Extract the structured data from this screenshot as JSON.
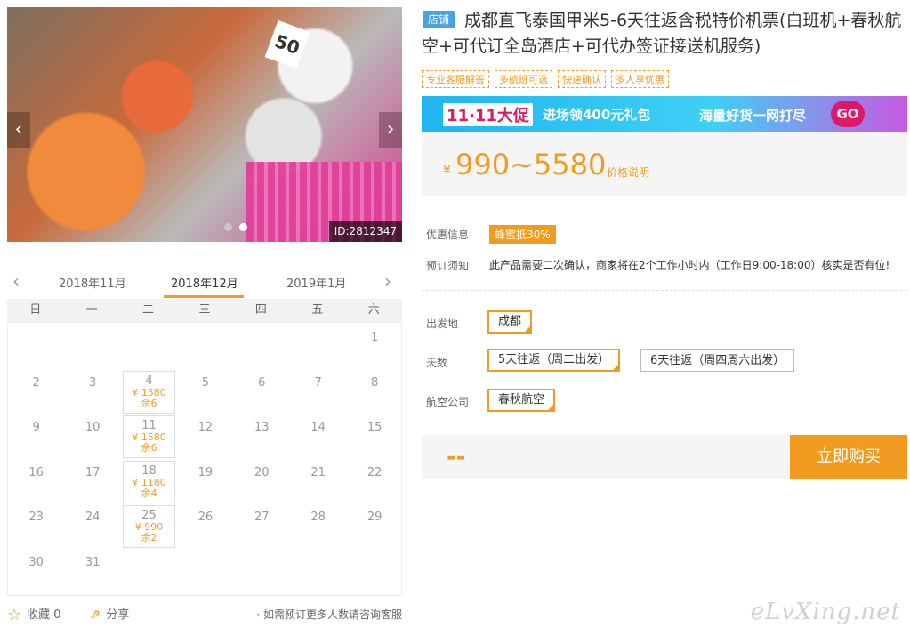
{
  "gallery": {
    "sign_text": "50",
    "image_id": "ID:2812347",
    "prev_icon": "chevron-left-icon",
    "next_icon": "chevron-right-icon"
  },
  "calendar": {
    "months": [
      "2018年11月",
      "2018年12月",
      "2019年1月"
    ],
    "active_month": "2018年12月",
    "weekdays": [
      "日",
      "一",
      "二",
      "三",
      "四",
      "五",
      "六"
    ],
    "days": [
      {
        "n": "1",
        "col": 6,
        "row": 0
      },
      {
        "n": "2",
        "col": 0,
        "row": 1
      },
      {
        "n": "3",
        "col": 1,
        "row": 1
      },
      {
        "n": "4",
        "col": 2,
        "row": 1,
        "price": "¥ 1580",
        "stock": "余6"
      },
      {
        "n": "5",
        "col": 3,
        "row": 1
      },
      {
        "n": "6",
        "col": 4,
        "row": 1
      },
      {
        "n": "7",
        "col": 5,
        "row": 1
      },
      {
        "n": "8",
        "col": 6,
        "row": 1
      },
      {
        "n": "9",
        "col": 0,
        "row": 2
      },
      {
        "n": "10",
        "col": 1,
        "row": 2
      },
      {
        "n": "11",
        "col": 2,
        "row": 2,
        "price": "¥ 1580",
        "stock": "余6"
      },
      {
        "n": "12",
        "col": 3,
        "row": 2
      },
      {
        "n": "13",
        "col": 4,
        "row": 2
      },
      {
        "n": "14",
        "col": 5,
        "row": 2
      },
      {
        "n": "15",
        "col": 6,
        "row": 2
      },
      {
        "n": "16",
        "col": 0,
        "row": 3
      },
      {
        "n": "17",
        "col": 1,
        "row": 3
      },
      {
        "n": "18",
        "col": 2,
        "row": 3,
        "price": "¥ 1180",
        "stock": "余4"
      },
      {
        "n": "19",
        "col": 3,
        "row": 3
      },
      {
        "n": "20",
        "col": 4,
        "row": 3
      },
      {
        "n": "21",
        "col": 5,
        "row": 3
      },
      {
        "n": "22",
        "col": 6,
        "row": 3
      },
      {
        "n": "23",
        "col": 0,
        "row": 4
      },
      {
        "n": "24",
        "col": 1,
        "row": 4
      },
      {
        "n": "25",
        "col": 2,
        "row": 4,
        "price": "¥ 990",
        "stock": "余2"
      },
      {
        "n": "26",
        "col": 3,
        "row": 4
      },
      {
        "n": "27",
        "col": 4,
        "row": 4
      },
      {
        "n": "28",
        "col": 5,
        "row": 4
      },
      {
        "n": "29",
        "col": 6,
        "row": 4
      },
      {
        "n": "30",
        "col": 0,
        "row": 5
      },
      {
        "n": "31",
        "col": 1,
        "row": 5
      }
    ]
  },
  "bottom": {
    "favorite_label": "收藏",
    "favorite_count": "0",
    "share_label": "分享",
    "tip": "· 如需预订更多人数请咨询客服"
  },
  "product": {
    "shop_tag": "店铺",
    "title": "成都直飞泰国甲米5-6天往返含税特价机票(白班机+春秋航空+可代订全岛酒店+可代办签证接送机服务)",
    "features": [
      "专业客服解答",
      "多航班可选",
      "快速确认",
      "多人享优惠"
    ]
  },
  "promo": {
    "badge": "11·11大促",
    "text1": "进场领400元礼包",
    "text2": "海量好货一网打尽",
    "go": "GO"
  },
  "price": {
    "currency": "¥",
    "range": "990~5580",
    "explain": "价格说明"
  },
  "info": {
    "discount_label": "优惠信息",
    "discount_value": "蜂蜜抵30%",
    "notice_label": "预订须知",
    "notice_value": "此产品需要二次确认，商家将在2个工作小时内（工作日9:00-18:00）核实是否有位!"
  },
  "options": {
    "departure_label": "出发地",
    "departure_value": "成都",
    "days_label": "天数",
    "days_options": [
      "5天往返（周二出发）",
      "6天往返（周四周六出发）"
    ],
    "airline_label": "航空公司",
    "airline_value": "春秋航空"
  },
  "buy": {
    "total": "--",
    "button": "立即购买"
  },
  "watermark": "eLvXing.net",
  "colors": {
    "accent": "#f29c1f",
    "shop_tag": "#4aa3df"
  }
}
